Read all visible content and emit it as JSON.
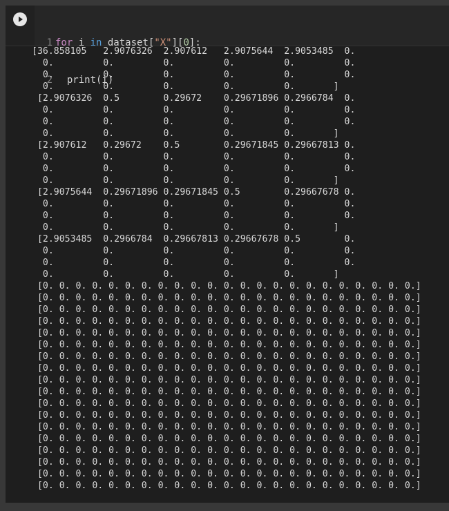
{
  "code": {
    "line_numbers": [
      "1",
      "2"
    ],
    "line1": {
      "kw_for": "for",
      "var": " i ",
      "kw_in": "in",
      "dataset": " dataset[",
      "str": "\"X\"",
      "idx_open": "][",
      "num": "0",
      "tail": "]:"
    },
    "line2": {
      "text": "  print(i)"
    }
  },
  "output_lines": [
    "[36.858105   2.9076326  2.907612   2.9075644  2.9053485  0.",
    "  0.         0.         0.         0.         0.         0.",
    "  0.         0.         0.         0.         0.         0.",
    "  0.         0.         0.         0.         0.       ]",
    " [2.9076326  0.5        0.29672    0.29671896 0.2966784  0.",
    "  0.         0.         0.         0.         0.         0.",
    "  0.         0.         0.         0.         0.         0.",
    "  0.         0.         0.         0.         0.       ]",
    " [2.907612   0.29672    0.5        0.29671845 0.29667813 0.",
    "  0.         0.         0.         0.         0.         0.",
    "  0.         0.         0.         0.         0.         0.",
    "  0.         0.         0.         0.         0.       ]",
    " [2.9075644  0.29671896 0.29671845 0.5        0.29667678 0.",
    "  0.         0.         0.         0.         0.         0.",
    "  0.         0.         0.         0.         0.         0.",
    "  0.         0.         0.         0.         0.       ]",
    " [2.9053485  0.2966784  0.29667813 0.29667678 0.5        0.",
    "  0.         0.         0.         0.         0.         0.",
    "  0.         0.         0.         0.         0.         0.",
    "  0.         0.         0.         0.         0.       ]",
    " [0. 0. 0. 0. 0. 0. 0. 0. 0. 0. 0. 0. 0. 0. 0. 0. 0. 0. 0. 0. 0. 0. 0.]",
    " [0. 0. 0. 0. 0. 0. 0. 0. 0. 0. 0. 0. 0. 0. 0. 0. 0. 0. 0. 0. 0. 0. 0.]",
    " [0. 0. 0. 0. 0. 0. 0. 0. 0. 0. 0. 0. 0. 0. 0. 0. 0. 0. 0. 0. 0. 0. 0.]",
    " [0. 0. 0. 0. 0. 0. 0. 0. 0. 0. 0. 0. 0. 0. 0. 0. 0. 0. 0. 0. 0. 0. 0.]",
    " [0. 0. 0. 0. 0. 0. 0. 0. 0. 0. 0. 0. 0. 0. 0. 0. 0. 0. 0. 0. 0. 0. 0.]",
    " [0. 0. 0. 0. 0. 0. 0. 0. 0. 0. 0. 0. 0. 0. 0. 0. 0. 0. 0. 0. 0. 0. 0.]",
    " [0. 0. 0. 0. 0. 0. 0. 0. 0. 0. 0. 0. 0. 0. 0. 0. 0. 0. 0. 0. 0. 0. 0.]",
    " [0. 0. 0. 0. 0. 0. 0. 0. 0. 0. 0. 0. 0. 0. 0. 0. 0. 0. 0. 0. 0. 0. 0.]",
    " [0. 0. 0. 0. 0. 0. 0. 0. 0. 0. 0. 0. 0. 0. 0. 0. 0. 0. 0. 0. 0. 0. 0.]",
    " [0. 0. 0. 0. 0. 0. 0. 0. 0. 0. 0. 0. 0. 0. 0. 0. 0. 0. 0. 0. 0. 0. 0.]",
    " [0. 0. 0. 0. 0. 0. 0. 0. 0. 0. 0. 0. 0. 0. 0. 0. 0. 0. 0. 0. 0. 0. 0.]",
    " [0. 0. 0. 0. 0. 0. 0. 0. 0. 0. 0. 0. 0. 0. 0. 0. 0. 0. 0. 0. 0. 0. 0.]",
    " [0. 0. 0. 0. 0. 0. 0. 0. 0. 0. 0. 0. 0. 0. 0. 0. 0. 0. 0. 0. 0. 0. 0.]",
    " [0. 0. 0. 0. 0. 0. 0. 0. 0. 0. 0. 0. 0. 0. 0. 0. 0. 0. 0. 0. 0. 0. 0.]",
    " [0. 0. 0. 0. 0. 0. 0. 0. 0. 0. 0. 0. 0. 0. 0. 0. 0. 0. 0. 0. 0. 0. 0.]",
    " [0. 0. 0. 0. 0. 0. 0. 0. 0. 0. 0. 0. 0. 0. 0. 0. 0. 0. 0. 0. 0. 0. 0.]",
    " [0. 0. 0. 0. 0. 0. 0. 0. 0. 0. 0. 0. 0. 0. 0. 0. 0. 0. 0. 0. 0. 0. 0.]",
    " [0. 0. 0. 0. 0. 0. 0. 0. 0. 0. 0. 0. 0. 0. 0. 0. 0. 0. 0. 0. 0. 0. 0.]"
  ],
  "icons": {
    "run": "play-circle-icon"
  },
  "colors": {
    "background": "#383838",
    "cell_background": "#1e1e1e",
    "code_background": "#262626",
    "keyword": "#c586c0",
    "keyword_in": "#569cd6",
    "string": "#ce9178",
    "number": "#b5cea8",
    "output_text": "#d8d8d8"
  }
}
